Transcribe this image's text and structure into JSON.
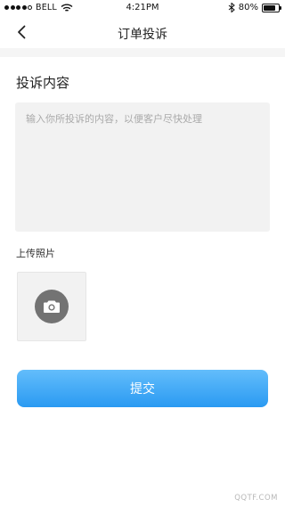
{
  "status_bar": {
    "carrier": "BELL",
    "time": "4:21PM",
    "battery_percent": "80%",
    "battery_level": 0.8
  },
  "nav": {
    "title": "订单投诉"
  },
  "complaint": {
    "section_title": "投诉内容",
    "placeholder": "输入你所投诉的内容，以便客户尽快处理",
    "value": ""
  },
  "upload": {
    "label": "上传照片"
  },
  "submit": {
    "label": "提交",
    "gradient_top": "#63bdfb",
    "gradient_bottom": "#2a9af2"
  },
  "watermark": {
    "text": "QQTF.COM"
  }
}
